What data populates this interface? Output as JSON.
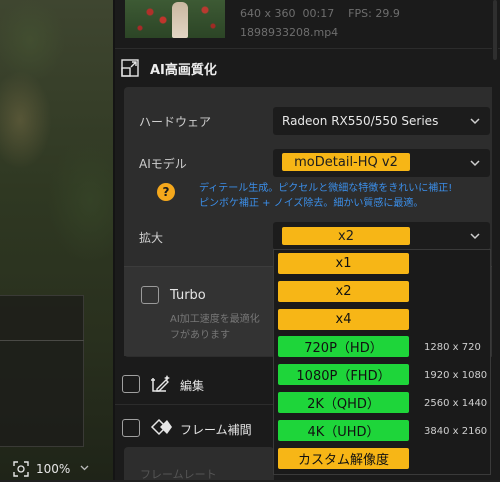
{
  "video": {
    "meta_line": "640 x 360  00:17    FPS: 29.9",
    "filename": "1898933208.mp4"
  },
  "preview": {
    "zoom": "100%"
  },
  "ai_section": {
    "title": "AI高画質化",
    "hardware_label": "ハードウェア",
    "hardware_value": "Radeon RX550/550 Series",
    "model_label": "AIモデル",
    "model_value": "moDetail-HQ  v2",
    "model_desc_line1": "ディテール生成。ピクセルと微細な特徴をきれいに補正!",
    "model_desc_line2": "ピンボケ補正 + ノイズ除去。細かい質感に最適。",
    "scale_label": "拡大",
    "scale_value": "x2",
    "turbo_label": "Turbo",
    "turbo_desc_line1": "AI加工速度を最適化",
    "turbo_desc_line2": "フがあります"
  },
  "sections": {
    "edit_label": "編集",
    "frame_label": "フレーム補間",
    "bottom_faded": "フレームレート"
  },
  "scale_menu": {
    "options": [
      {
        "label": "x1",
        "sub": "",
        "color": "#f7b616"
      },
      {
        "label": "x2",
        "sub": "",
        "color": "#f7b616"
      },
      {
        "label": "x4",
        "sub": "",
        "color": "#f7b616"
      },
      {
        "label": "720P（HD）",
        "sub": "1280 x 720",
        "color": "#1ed53a"
      },
      {
        "label": "1080P（FHD）",
        "sub": "1920 x 1080",
        "color": "#1ed53a"
      },
      {
        "label": "2K（QHD）",
        "sub": "2560 x 1440",
        "color": "#1ed53a"
      },
      {
        "label": "4K（UHD）",
        "sub": "3840 x 2160",
        "color": "#1ed53a"
      },
      {
        "label": "カスタム解像度",
        "sub": "",
        "color": "#f7b616"
      }
    ]
  }
}
